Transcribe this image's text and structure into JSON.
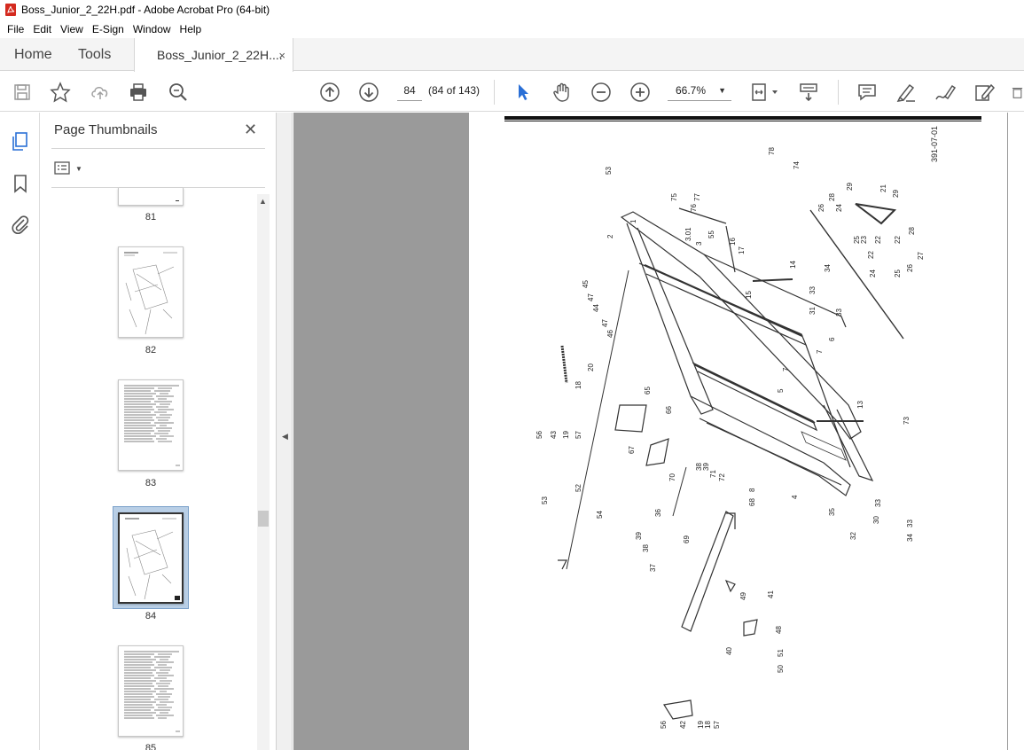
{
  "window": {
    "title": "Boss_Junior_2_22H.pdf - Adobe Acrobat Pro (64-bit)"
  },
  "menu": [
    "File",
    "Edit",
    "View",
    "E-Sign",
    "Window",
    "Help"
  ],
  "tabs": {
    "home": "Home",
    "tools": "Tools",
    "document": "Boss_Junior_2_22H....",
    "close": "×"
  },
  "toolbar": {
    "icons": [
      "save-icon",
      "bookmark-star-icon",
      "upload-icon",
      "print-icon",
      "search-zoom-icon",
      "prev-page-icon",
      "next-page-icon",
      "select-arrow-icon",
      "hand-tool-icon",
      "zoom-out-icon",
      "zoom-in-icon",
      "page-fit-icon",
      "scroll-mode-icon",
      "comment-icon",
      "highlight-icon",
      "sign-icon",
      "edit-icon",
      "delete-icon"
    ],
    "page_number": "84",
    "page_of": "(84 of 143)",
    "zoom": "66.7%"
  },
  "sidebar": {
    "title": "Page Thumbnails",
    "thumbnails": [
      {
        "label": "81"
      },
      {
        "label": "82"
      },
      {
        "label": "83"
      },
      {
        "label": "84",
        "selected": true
      },
      {
        "label": "85"
      }
    ]
  },
  "document": {
    "drawing_number": "391-07-01"
  },
  "colors": {
    "accent": "#2a6fd6",
    "pdf_red": "#d42a1f",
    "doc_bg": "#9a9a9a"
  }
}
